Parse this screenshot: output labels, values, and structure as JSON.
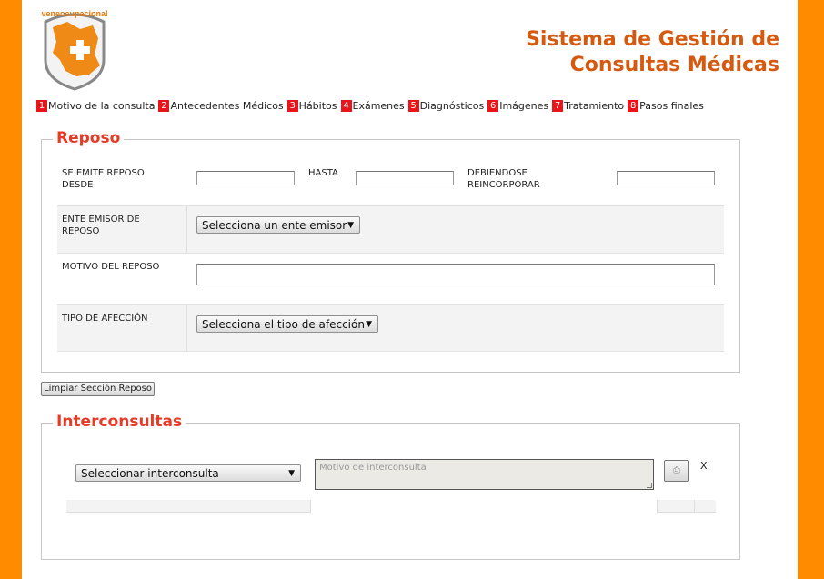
{
  "app": {
    "logo_text": "veneocupacional",
    "title_line1": "Sistema de Gestión de",
    "title_line2": "Consultas Médicas"
  },
  "steps": [
    {
      "num": "1",
      "label": "Motivo de la consulta"
    },
    {
      "num": "2",
      "label": "Antecedentes Médicos"
    },
    {
      "num": "3",
      "label": "Hábitos"
    },
    {
      "num": "4",
      "label": "Exámenes"
    },
    {
      "num": "5",
      "label": "Diagnósticos"
    },
    {
      "num": "6",
      "label": "Imágenes"
    },
    {
      "num": "7",
      "label": "Tratamiento"
    },
    {
      "num": "8",
      "label": "Pasos finales"
    }
  ],
  "reposo": {
    "legend": "Reposo",
    "desde_label": "SE EMITE REPOSO DESDE",
    "hasta_label": "HASTA",
    "reincorporar_label": "DEBIENDOSE REINCORPORAR",
    "desde_value": "",
    "hasta_value": "",
    "reincorporar_value": "",
    "ente_label": "ENTE EMISOR DE REPOSO",
    "ente_selected": "Selecciona un ente emisor",
    "motivo_label": "MOTIVO DEL REPOSO",
    "motivo_value": "",
    "tipo_label": "TIPO DE AFECCIÓN",
    "tipo_selected": "Selecciona el tipo de afección",
    "clear_button": "Limpiar Sección Reposo"
  },
  "interconsultas": {
    "legend": "Interconsultas",
    "select_selected": "Seleccionar interconsulta",
    "motivo_placeholder": "Motivo de interconsulta",
    "remove_label": "X"
  },
  "colors": {
    "background": "#ff8c00",
    "title": "#d55a0f",
    "legend": "#e53b27",
    "step_badge": "#e8161b"
  },
  "icons": {
    "logo": "medical-cross-shield-icon",
    "dropdown": "triangle-down-icon",
    "print": "printer-icon"
  }
}
